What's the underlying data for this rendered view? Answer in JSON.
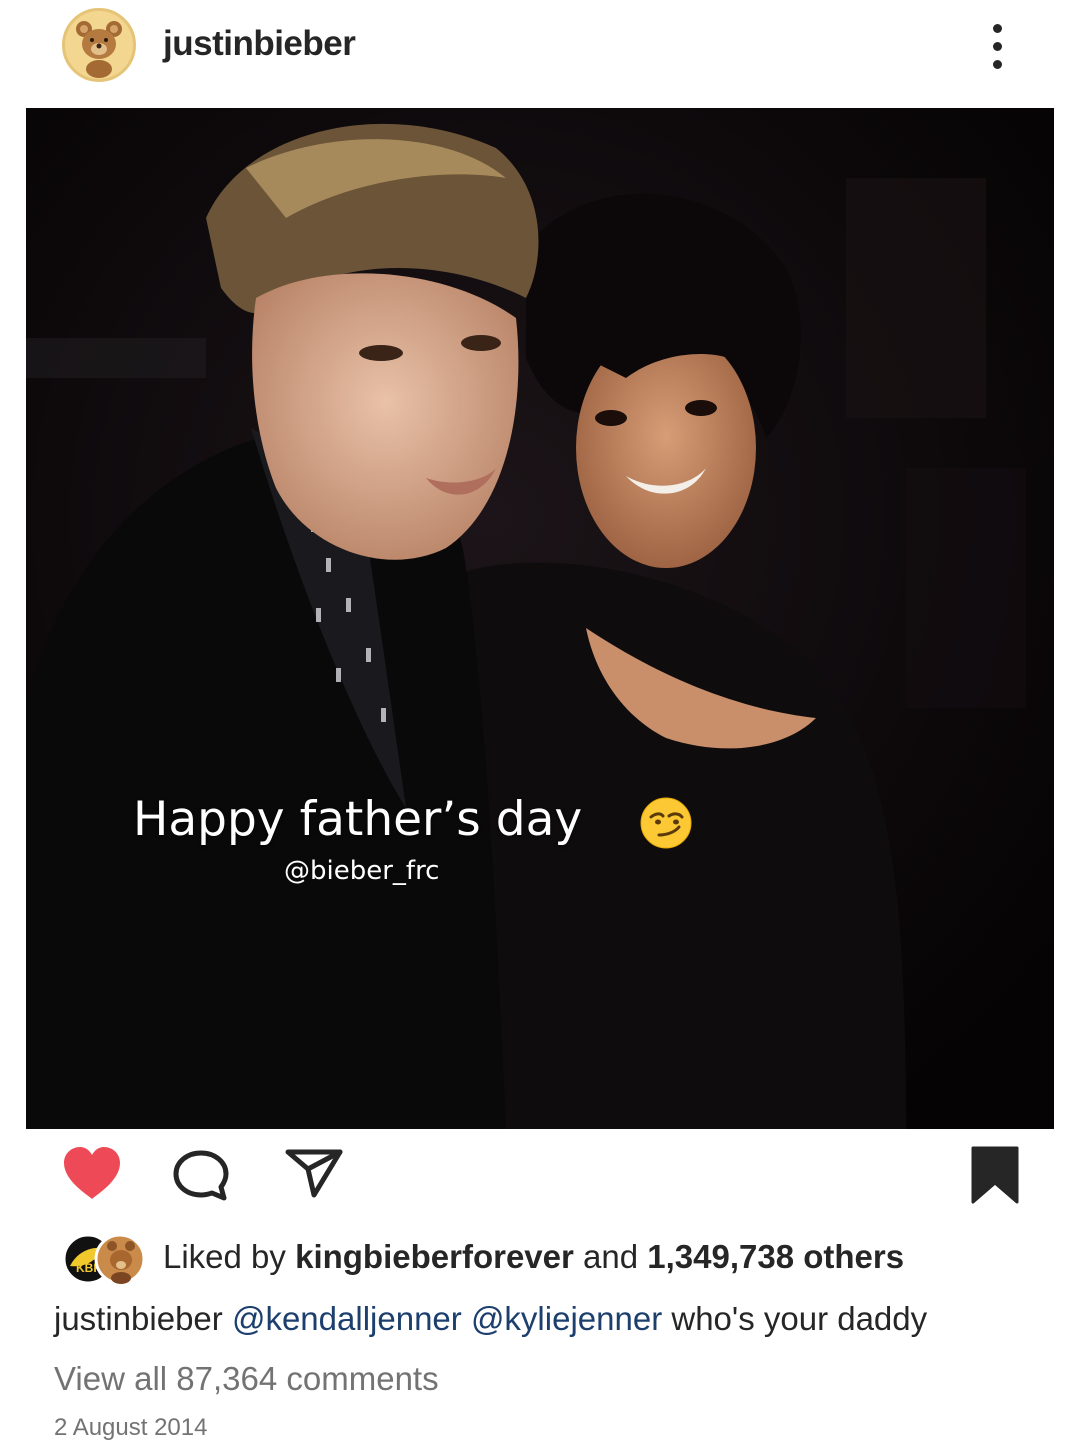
{
  "header": {
    "username": "justinbieber",
    "avatar_icon": "teddy-bear-icon",
    "more_icon": "more-vertical-icon"
  },
  "photo": {
    "overlay_text": "Happy father’s day",
    "overlay_emoji": "smirk-emoji-icon",
    "credit": "@bieber_frc"
  },
  "actions": {
    "like_icon": "heart-filled-icon",
    "like_color": "#ed4956",
    "comment_icon": "comment-icon",
    "share_icon": "send-icon",
    "save_icon": "bookmark-filled-icon"
  },
  "likes": {
    "prefix": "Liked by ",
    "liker": "kingbieberforever",
    "middle": " and ",
    "count": "1,349,738 others",
    "liker_avatar_text": "KBF"
  },
  "caption": {
    "username": "justinbieber",
    "mention1": "@kendalljenner",
    "mention2": "@kyliejenner",
    "text": "who's your daddy"
  },
  "comments": {
    "view_all": "View all 87,364 comments"
  },
  "date": "2 August 2014"
}
